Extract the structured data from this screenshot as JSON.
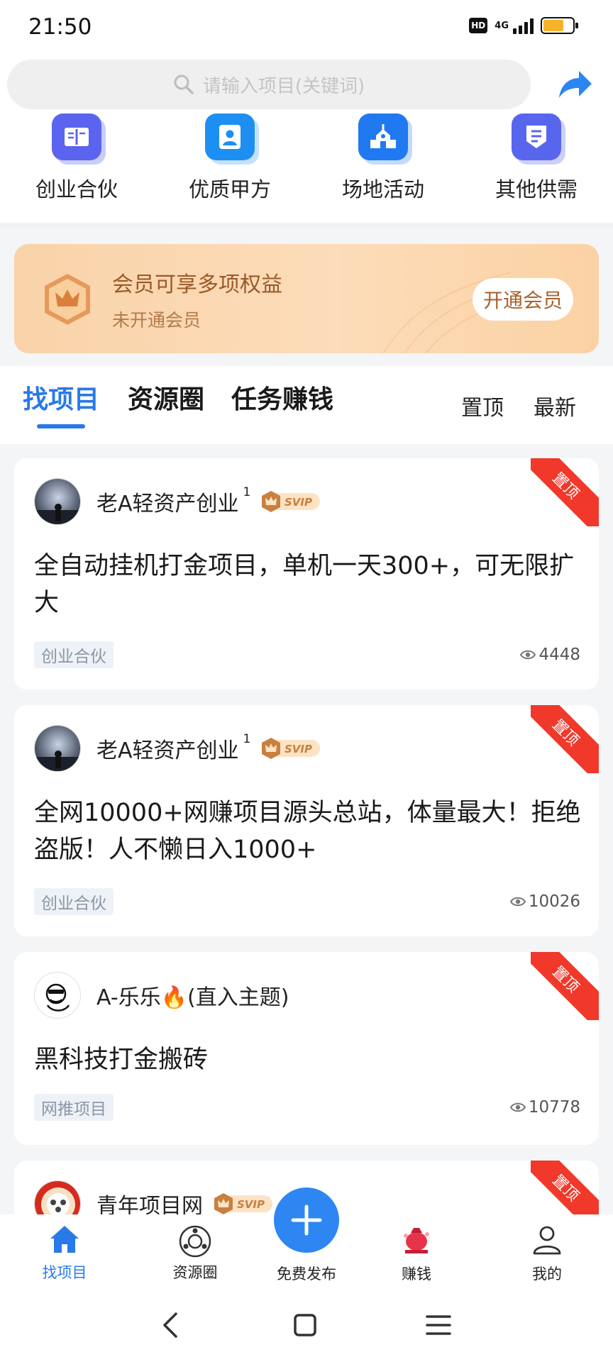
{
  "status_bar": {
    "time": "21:50",
    "hd_badge": "HD",
    "network": "4G",
    "battery_level": 0.7,
    "icons": [
      "hd-icon",
      "signal-icon",
      "battery-icon"
    ]
  },
  "search": {
    "placeholder": "请输入项目(关键词)",
    "icon": "search-icon",
    "share_icon": "share-icon"
  },
  "categories": [
    {
      "label": "创业合伙",
      "icon": "book-icon",
      "color": "#5a64ee"
    },
    {
      "label": "优质甲方",
      "icon": "contact-card-icon",
      "color": "#1e8ff2"
    },
    {
      "label": "场地活动",
      "icon": "building-icon",
      "color": "#2079f0"
    },
    {
      "label": "其他供需",
      "icon": "shield-list-icon",
      "color": "#5866ee"
    }
  ],
  "member_banner": {
    "title": "会员可享多项权益",
    "subtitle": "未开通会员",
    "button": "开通会员",
    "icon": "crown-badge-icon"
  },
  "tabs": {
    "items": [
      "找项目",
      "资源圈",
      "任务赚钱"
    ],
    "active": 0,
    "sort_options": [
      "置顶",
      "最新"
    ]
  },
  "feed": [
    {
      "author": "老A轻资产创业",
      "level": "1",
      "badge": "SVIP",
      "title": "全自动挂机打金项目，单机一天300+，可无限扩大",
      "tag": "创业合伙",
      "views": "4448",
      "pinned_label": "置顶"
    },
    {
      "author": "老A轻资产创业",
      "level": "1",
      "badge": "SVIP",
      "title": "全网10000+网赚项目源头总站，体量最大！拒绝盗版！人不懒日入1000+",
      "tag": "创业合伙",
      "views": "10026",
      "pinned_label": "置顶"
    },
    {
      "author": "A-乐乐🔥(直入主题)",
      "level": "",
      "badge": "",
      "title": "黑科技打金搬砖",
      "tag": "网推项目",
      "views": "10778",
      "pinned_label": "置顶"
    },
    {
      "author": "青年项目网",
      "level": "",
      "badge": "SVIP",
      "title": "",
      "tag": "",
      "views": "",
      "pinned_label": "置顶"
    }
  ],
  "bottom_nav": {
    "items": [
      {
        "label": "找项目",
        "icon": "home-icon"
      },
      {
        "label": "资源圈",
        "icon": "circle-network-icon"
      },
      {
        "label": "免费发布",
        "icon": "plus-icon"
      },
      {
        "label": "赚钱",
        "icon": "money-bag-icon"
      },
      {
        "label": "我的",
        "icon": "user-icon"
      }
    ],
    "active": 0
  },
  "system_nav": [
    "back-icon",
    "home-square-icon",
    "menu-icon"
  ],
  "colors": {
    "accent": "#2979e8",
    "pin_ribbon": "#f0382b",
    "member_text": "#9a5a28"
  }
}
